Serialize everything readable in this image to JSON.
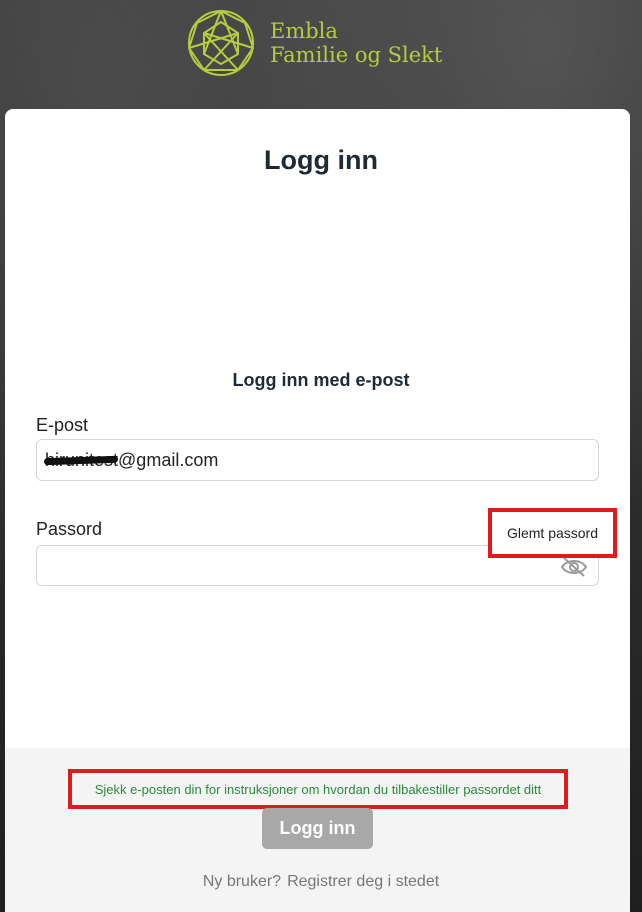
{
  "brand": {
    "line1": "Embla",
    "line2": "Familie og Slekt",
    "color": "#b6cc3e"
  },
  "login": {
    "title": "Logg inn",
    "subtitle": "Logg inn med e-post",
    "email_label": "E-post",
    "email_value": "hirunitest@gmail.com",
    "password_label": "Passord",
    "password_value": "",
    "forgot_link": "Glemt passord",
    "reset_message": "Sjekk e-posten din for instruksjoner om hvordan du tilbakestiller passordet ditt",
    "submit_label": "Logg inn",
    "new_user_text": "Ny bruker?",
    "register_link": "Registrer deg i stedet"
  },
  "icons": {
    "logo": "embla-logo-icon",
    "password_toggle": "eye-slash-icon"
  },
  "colors": {
    "highlight": "#e01b1b",
    "message": "#2b8a3e",
    "button_disabled": "#a8a8a8"
  }
}
